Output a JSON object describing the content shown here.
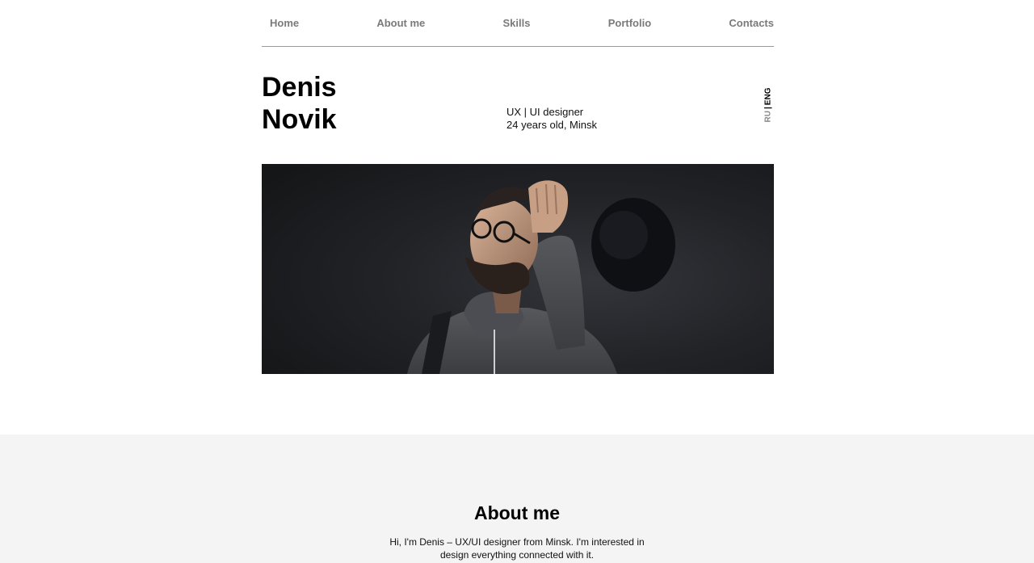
{
  "nav": {
    "items": [
      {
        "label": "Home"
      },
      {
        "label": "About me"
      },
      {
        "label": "Skills"
      },
      {
        "label": "Portfolio"
      },
      {
        "label": "Contacts"
      }
    ]
  },
  "hero": {
    "first_name": "Denis",
    "last_name": "Novik",
    "role": "UX | UI designer",
    "age_city": "24 years old, Minsk"
  },
  "lang": {
    "ru": "RU",
    "separator": "|",
    "eng": "ENG",
    "active": "ENG"
  },
  "photo": {
    "icon": "portrait-photo"
  },
  "about": {
    "title": "About me",
    "text": "Hi, I'm Denis – UX/UI designer from Minsk. I'm interested in design everything connected with it."
  },
  "colors": {
    "nav_text": "#7a7a7a",
    "about_bg": "#f4f4f4",
    "photo_bg": "#1f2022"
  }
}
